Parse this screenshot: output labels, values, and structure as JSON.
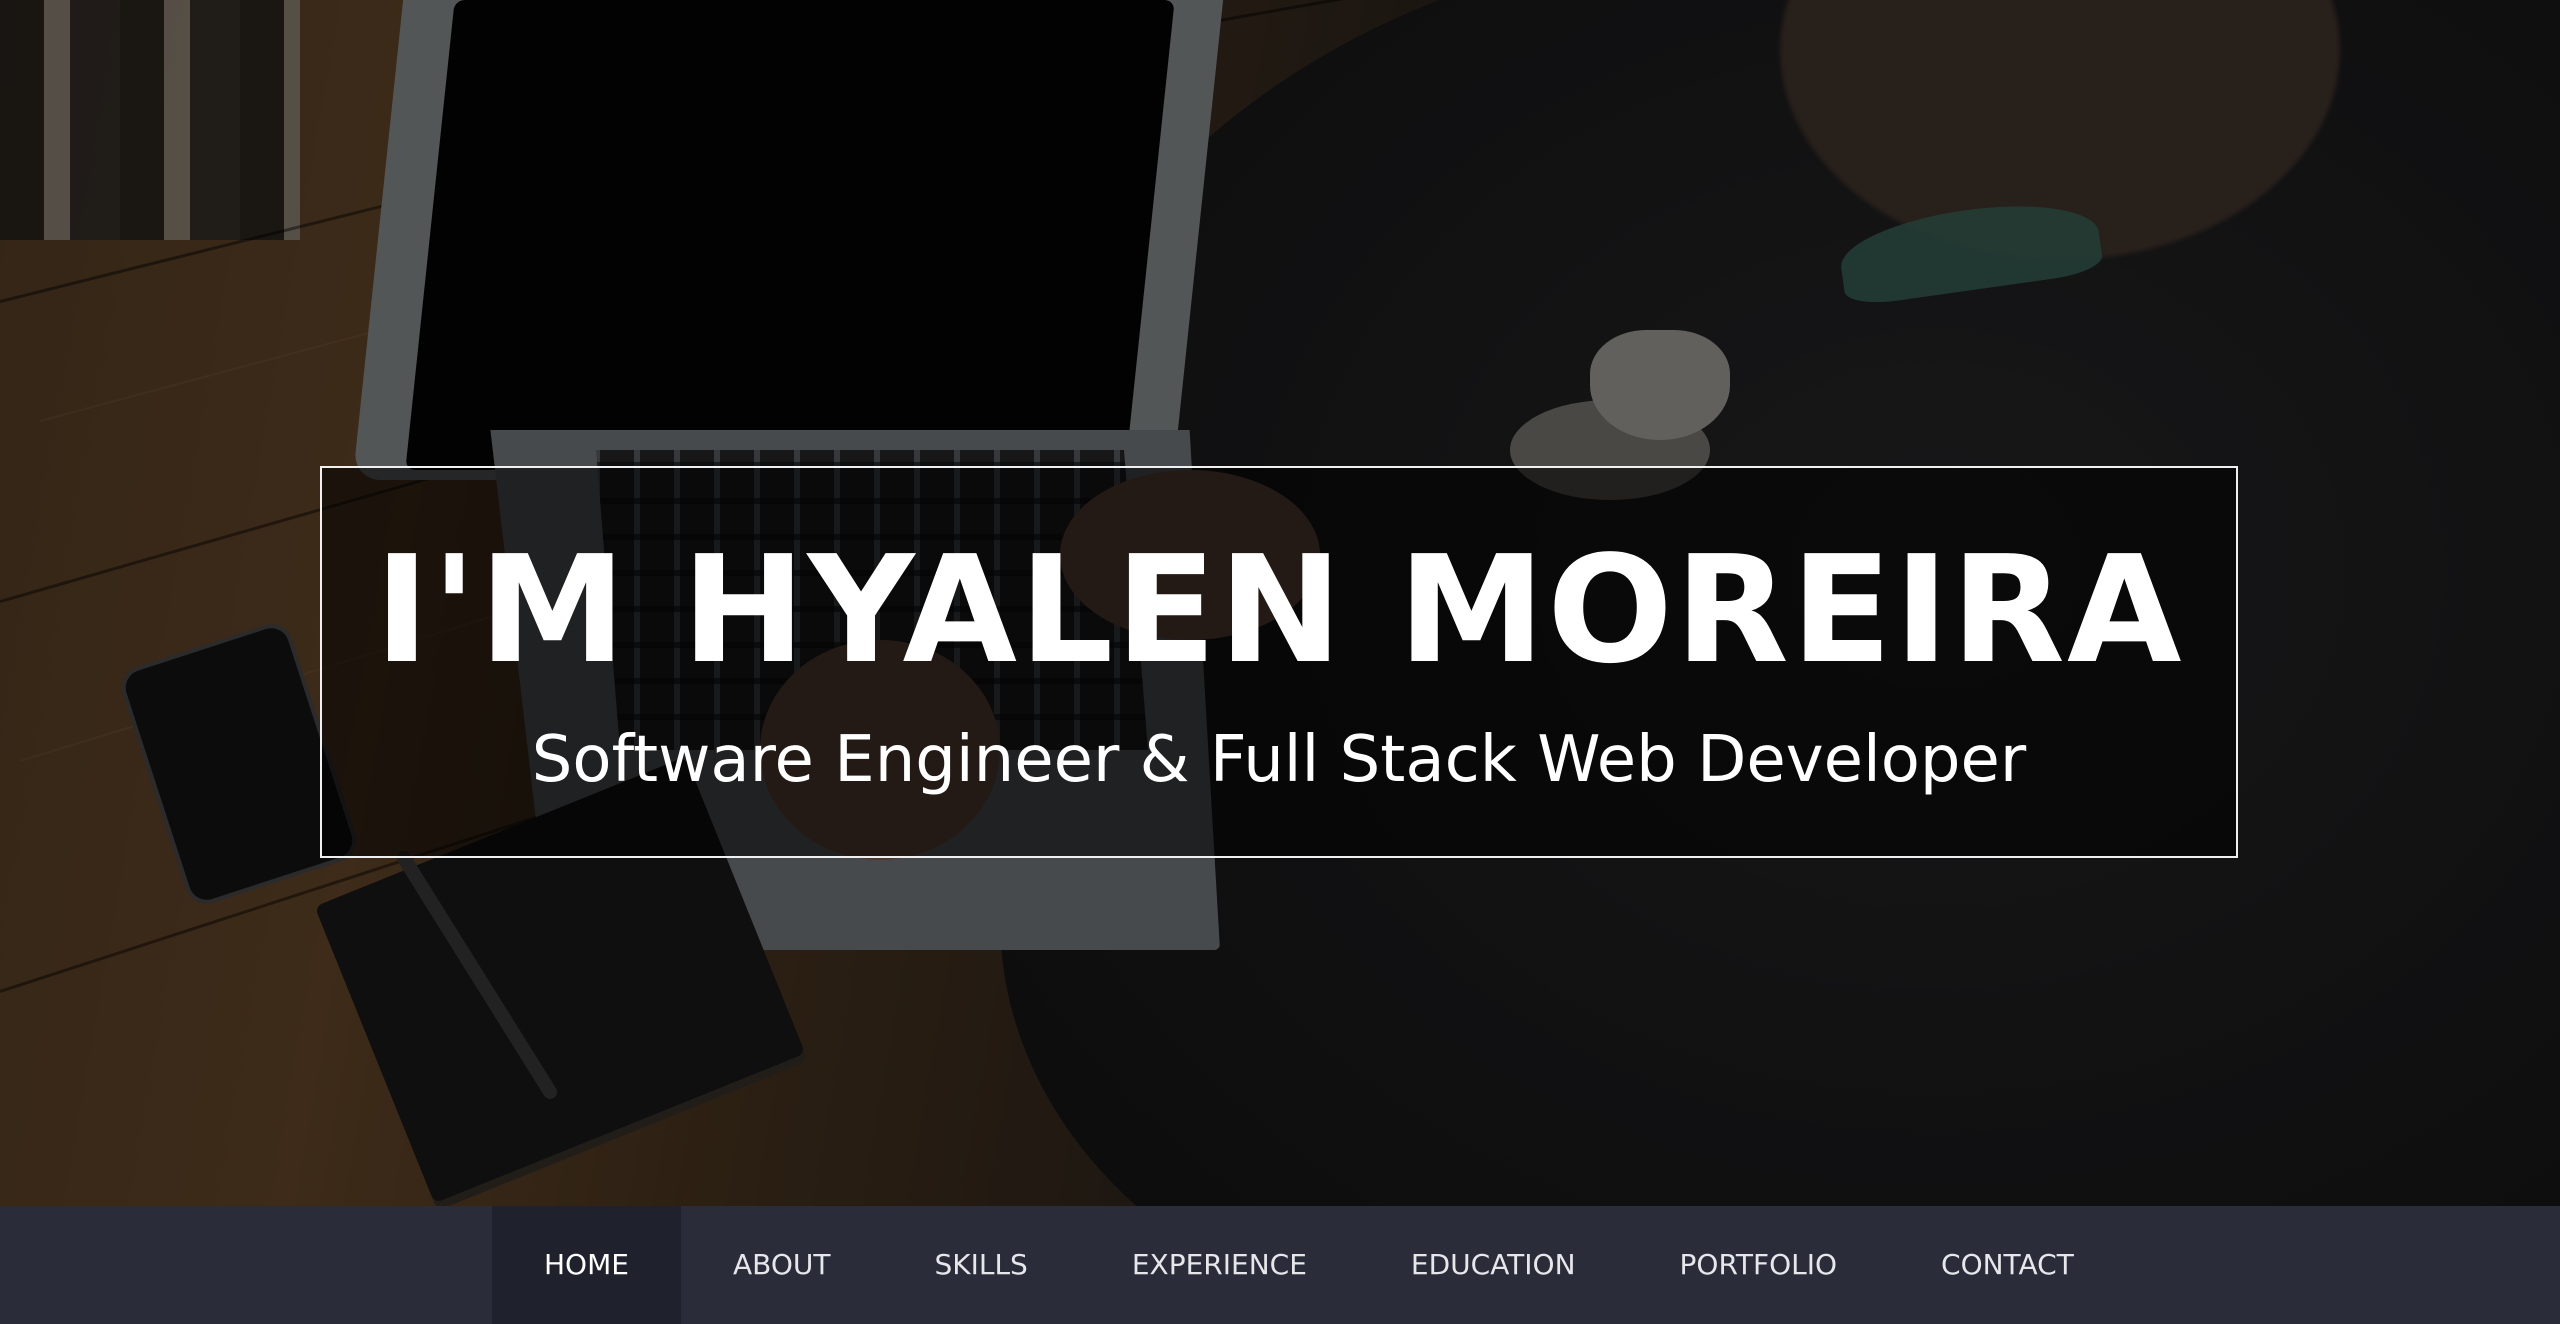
{
  "hero": {
    "title": "I'M HYALEN MOREIRA",
    "subtitle": "Software Engineer & Full Stack Web Developer"
  },
  "nav": {
    "items": [
      {
        "label": "HOME",
        "active": true
      },
      {
        "label": "ABOUT",
        "active": false
      },
      {
        "label": "SKILLS",
        "active": false
      },
      {
        "label": "EXPERIENCE",
        "active": false
      },
      {
        "label": "EDUCATION",
        "active": false
      },
      {
        "label": "PORTFOLIO",
        "active": false
      },
      {
        "label": "CONTACT",
        "active": false
      }
    ]
  },
  "colors": {
    "nav_background": "#2a2d39",
    "nav_active": "#1f222c",
    "title_text": "#ffffff"
  }
}
